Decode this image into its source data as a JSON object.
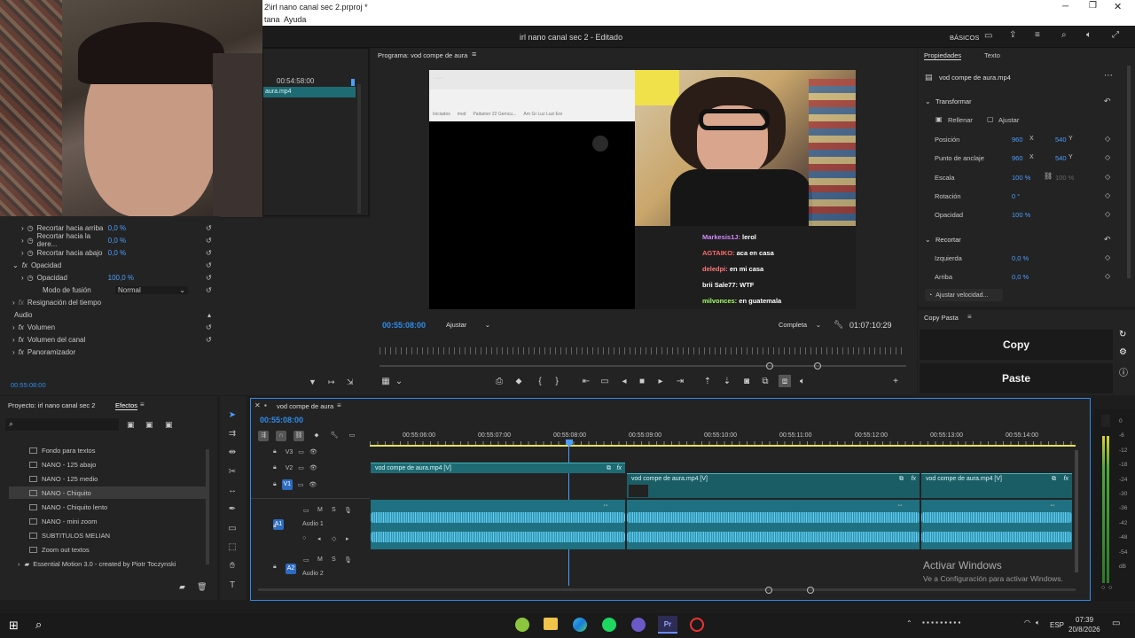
{
  "window": {
    "title": "2\\irl nano canal sec 2.prproj *",
    "menu": [
      "tana",
      "Ayuda"
    ],
    "controls": [
      "minimize-icon",
      "maximize-icon",
      "close-icon"
    ]
  },
  "app_header": {
    "center_title": "irl nano canal sec 2 - Editado",
    "workspace_label": "BÁSICOS"
  },
  "source_panel": {
    "timecode": "00:54:58:00",
    "clip_label": "aura.mp4"
  },
  "effects_controls": {
    "rows": [
      {
        "label": "Recortar hacia arriba",
        "value": "0,0 %"
      },
      {
        "label": "Recortar hacia la dere...",
        "value": "0,0 %"
      },
      {
        "label": "Recortar hacia abajo",
        "value": "0,0 %"
      }
    ],
    "opacity_section": "Opacidad",
    "opacity_label": "Opacidad",
    "opacity_value": "100,0 %",
    "blend_label": "Modo de fusión",
    "blend_value": "Normal",
    "time_remap": "Resignación del tiempo",
    "audio_header": "Audio",
    "audio_rows": [
      "Volumen",
      "Volumen del canal",
      "Panoramizador"
    ],
    "timecode": "00:55:08:00"
  },
  "program_monitor": {
    "title": "Programa: vod compe de aura",
    "timecode_current": "00:55:08:00",
    "fit_label": "Ajustar",
    "quality_label": "Completa",
    "timecode_total": "01:07:10:29"
  },
  "video_overlay": {
    "browser_tabs": [
      "Iniciados",
      "mod",
      "Paitamer 22 Gerncu...",
      "Arn Gr Luz Luzi Ere"
    ],
    "chat_lines": [
      {
        "user": "Markesis1J:",
        "msg": "lerol"
      },
      {
        "user": "AGTAIKO:",
        "msg": "aca en casa"
      },
      {
        "user": "deledpi:",
        "msg": "en mi casa"
      },
      {
        "user": "brii Sale77:",
        "msg": "WTF"
      },
      {
        "user": "milvonces:",
        "msg": "en guatemala"
      }
    ]
  },
  "properties_panel": {
    "tabs": [
      "Propiedades",
      "Texto"
    ],
    "clip_name": "vod compe de aura.mp4",
    "transform_header": "Transformar",
    "fill_label": "Rellenar",
    "fit_label": "Ajustar",
    "rows": [
      {
        "label": "Posición",
        "x": "960",
        "y": "540"
      },
      {
        "label": "Punto de anclaje",
        "x": "960",
        "y": "540"
      }
    ],
    "scale_label": "Escala",
    "scale_value": "100 %",
    "scale_value2": "100 %",
    "rotation_label": "Rotación",
    "rotation_value": "0 °",
    "opacity_label": "Opacidad",
    "opacity_value": "100 %",
    "crop_header": "Recortar",
    "left_label": "Izquierda",
    "left_value": "0,0 %",
    "top_label": "Arriba",
    "top_value": "0,0 %",
    "speed_button": "Ajustar velocidad...",
    "axis_x": "X",
    "axis_y": "Y"
  },
  "copy_paste_panel": {
    "title": "Copy Pasta",
    "copy_label": "Copy",
    "paste_label": "Paste"
  },
  "project_panel": {
    "tabs": [
      "Proyecto: irl nano canal sec 2",
      "Efectos"
    ],
    "items": [
      "Fondo para textos",
      "NANO - 125 abajo",
      "NANO - 125 medio",
      "NANO - Chiquito",
      "NANO - Chiquito lento",
      "NANO - mini zoom",
      "SUBTITULOS MELIAN",
      "Zoom out textos"
    ],
    "folder_item": "Essential Motion 3.0 - created by Piotr Toczynski"
  },
  "timeline": {
    "sequence_name": "vod compe de aura",
    "timecode": "00:55:08:00",
    "ruler": [
      "00:55:06:00",
      "00:55:07:00",
      "00:55:08:00",
      "00:55:09:00",
      "00:55:10:00",
      "00:55:11:00",
      "00:55:12:00",
      "00:55:13:00",
      "00:55:14:00"
    ],
    "tracks_video": [
      "V3",
      "V2",
      "V1"
    ],
    "tracks_audio": [
      {
        "id": "A1",
        "name": "Audio 1"
      },
      {
        "id": "A2",
        "name": "Audio 2"
      }
    ],
    "clips": [
      "vod compe de aura.mp4 [V]",
      "vod compe de aura.mp4 [V]",
      "vod compe de aura.mp4 [V]"
    ],
    "activation_title": "Activar Windows",
    "activation_sub": "Ve a Configuración para activar Windows."
  },
  "meter": {
    "labels": [
      "0",
      "-6",
      "-12",
      "-18",
      "-24",
      "-30",
      "-36",
      "-42",
      "-48",
      "-54",
      "dB"
    ]
  },
  "taskbar": {
    "time": "07:39",
    "date": "20/8/2026",
    "lang": "ESP"
  },
  "colors": {
    "accent": "#2d8ceb",
    "clip_video": "#1e6b73",
    "clip_audio": "#1f7080",
    "playhead": "#4a9eff"
  }
}
